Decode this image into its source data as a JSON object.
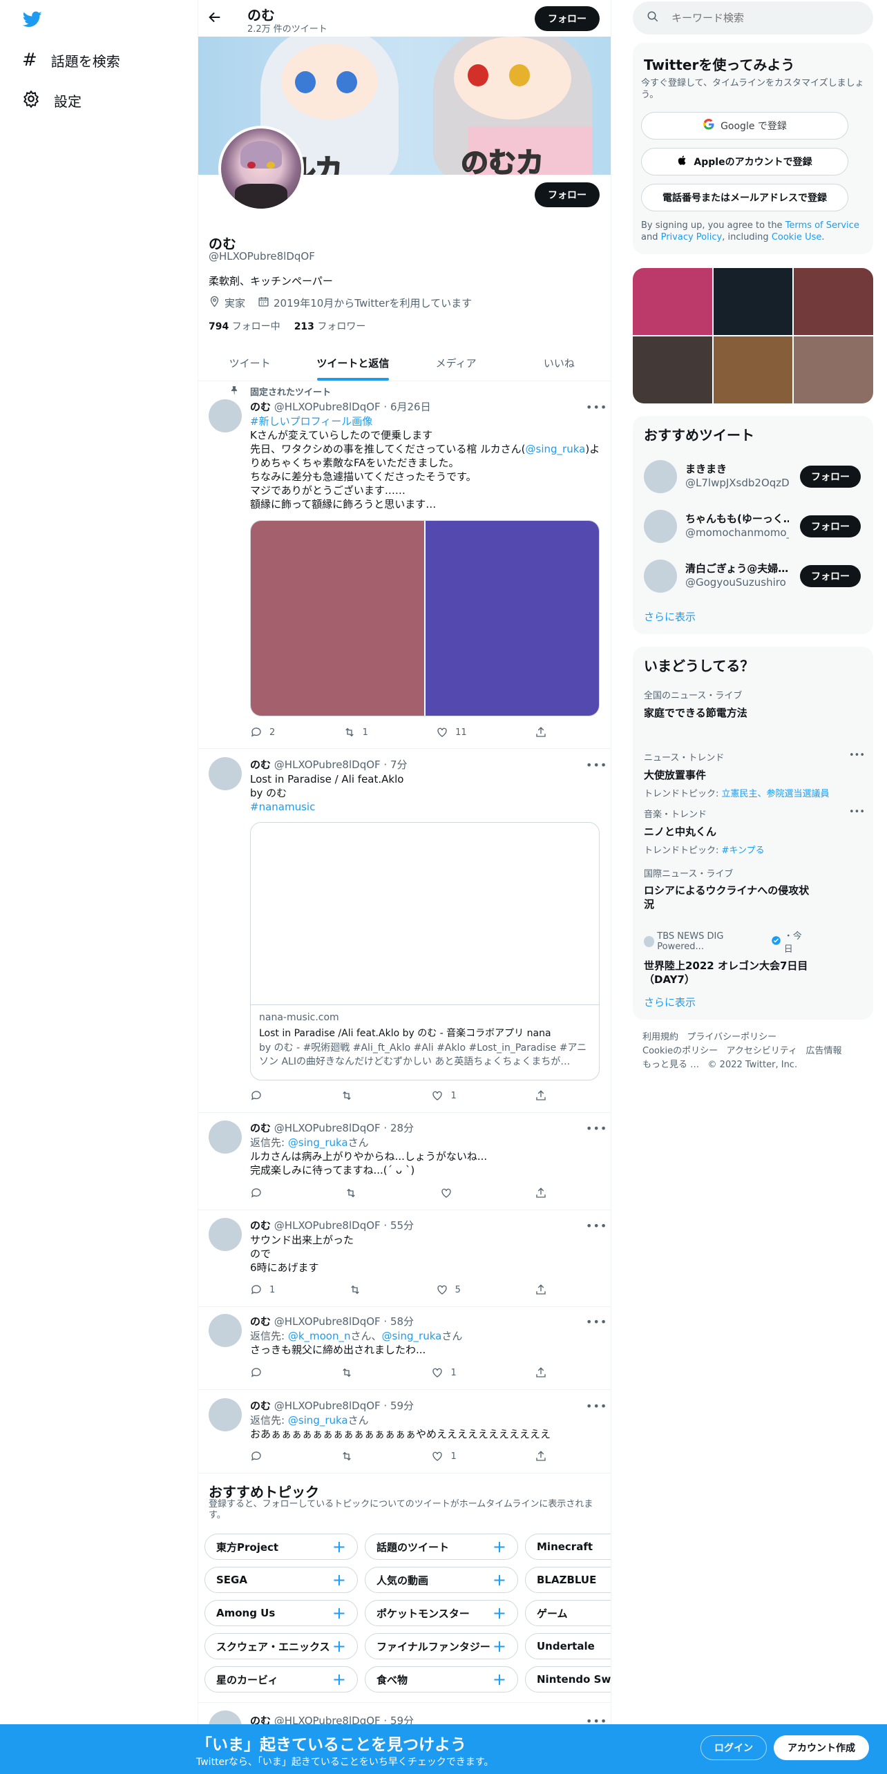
{
  "left_nav": {
    "explore_label": "話題を検索",
    "settings_label": "設定"
  },
  "header": {
    "name": "のむ",
    "tweet_count": "2.2万 件のツイート",
    "follow_label": "フォロー"
  },
  "banner": {
    "left_text": "ルカ",
    "right_text": "のむカ"
  },
  "profile": {
    "name": "のむ",
    "handle": "@HLXOPubre8lDqOF",
    "bio": "柔軟剤、キッチンペーパー",
    "location": "実家",
    "joined": "2019年10月からTwitterを利用しています",
    "following_count": "794",
    "following_label": "フォロー中",
    "followers_count": "213",
    "followers_label": "フォロワー",
    "follow_label": "フォロー"
  },
  "tabs": [
    {
      "label": "ツイート"
    },
    {
      "label": "ツイートと返信"
    },
    {
      "label": "メディア"
    },
    {
      "label": "いいね"
    }
  ],
  "tweets": [
    {
      "pinned_label": "固定されたツイート",
      "name": "のむ",
      "meta": "@HLXOPubre8lDqOF · 6月26日",
      "hashtag": "#新しいプロフィール画像",
      "line1": "Kさんが変えていらしたので便乗します",
      "line2a": "先日、ワタクシめの事を推してくださっている棺 ルカさん(",
      "mention": "@sing_ruka",
      "line2b": ")よ",
      "line3": "りめちゃくちゃ素敵なFAをいただきました。",
      "line4": "ちなみに差分も急遽描いてくださったそうです。",
      "line5": "マジでありがとうございます……",
      "line6": "額縁に飾って額縁に飾ろうと思います…",
      "media_colors": [
        "#a4606c",
        "#5349ae"
      ],
      "replies": "2",
      "retweets": "1",
      "likes": "11"
    },
    {
      "name": "のむ",
      "meta": "@HLXOPubre8lDqOF · 7分",
      "line1": "Lost in Paradise / Ali feat.Aklo",
      "line2": "by のむ",
      "hashtag": "#nanamusic",
      "card_domain": "nana-music.com",
      "card_title": "Lost in Paradise /Ali feat.Aklo by のむ - 音楽コラボアプリ nana",
      "card_desc": "by のむ - #呪術廻戦 #Ali_ft_Aklo #Ali #Aklo #Lost_in_Paradise #アニソン ALIの曲好きなんだけどむずかしい あと英語ちょくちょくまちが…",
      "likes": "1"
    },
    {
      "name": "のむ",
      "meta": "@HLXOPubre8lDqOF · 28分",
      "reply_prefix": "返信先: ",
      "reply_to": "@sing_ruka",
      "reply_suffix": "さん",
      "line1": "ルカさんは病み上がりやからね...しょうがないね...",
      "line2": "完成楽しみに待ってますね...(´ ᴗ `)"
    },
    {
      "name": "のむ",
      "meta": "@HLXOPubre8lDqOF · 55分",
      "line1": "サウンド出来上がった",
      "line2": "ので",
      "line3": "6時にあげます",
      "replies": "1",
      "likes": "5"
    },
    {
      "name": "のむ",
      "meta": "@HLXOPubre8lDqOF · 58分",
      "reply_prefix": "返信先: ",
      "reply_to1": "@k_moon_n",
      "reply_mid": "さん、",
      "reply_to2": "@sing_ruka",
      "reply_suffix": "さん",
      "line1": "さっきも親父に締め出されましたわ...",
      "likes": "1"
    },
    {
      "name": "のむ",
      "meta": "@HLXOPubre8lDqOF · 59分",
      "reply_prefix": "返信先: ",
      "reply_to": "@sing_ruka",
      "reply_suffix": "さん",
      "line1": "おあぁぁぁぁぁぁぁぁぁぁぁぁぁぁやめえええええええええええ",
      "likes": "1"
    }
  ],
  "topics": {
    "title": "おすすめトピック",
    "desc": "登録すると、フォローしているトピックについてのツイートがホームタイムラインに表示されます。",
    "items": [
      "東方Project",
      "話題のツイート",
      "Minecraft",
      "SEGA",
      "人気の動画",
      "BLAZBLUE",
      "Among Us",
      "ポケットモンスター",
      "ゲーム",
      "スクウェア・エニックス",
      "ファイナルファンタジー",
      "Undertale",
      "星のカービィ",
      "食べ物",
      "Nintendo Switch"
    ]
  },
  "peek_tweet": {
    "name": "のむ",
    "meta": "@HLXOPubre8lDqOF · 59分"
  },
  "search": {
    "placeholder": "キーワード検索"
  },
  "signup": {
    "title": "Twitterを使ってみよう",
    "desc": "今すぐ登録して、タイムラインをカスタマイズしましょう。",
    "google": "Google で登録",
    "apple": "Appleのアカウントで登録",
    "phone": "電話番号またはメールアドレスで登録",
    "terms_a": "By signing up, you agree to the ",
    "terms_link1": "Terms of Service",
    "terms_b": " and ",
    "terms_link2": "Privacy Policy",
    "terms_c": ", including ",
    "terms_link3": "Cookie Use",
    "terms_d": "."
  },
  "media_grid": {
    "colors": [
      "#bb3a6a",
      "#162028",
      "#733a3c",
      "#433a37",
      "#875e3a",
      "#8c6e64"
    ]
  },
  "recommended": {
    "title": "おすすめツイート",
    "users": [
      {
        "name": "まきまき",
        "handle": "@L7lwpJXsdb2OqzD"
      },
      {
        "name": "ちゃんもも(ゆーっく…",
        "handle": "@momochanmomo_"
      },
      {
        "name": "清白ごぎょう@夫婦…",
        "handle": "@GogyouSuzushiro"
      }
    ],
    "follow_label": "フォロー",
    "more": "さらに表示"
  },
  "trends": {
    "title": "いまどうしてる？",
    "items": [
      {
        "sub": "全国のニュース・ライブ",
        "title": "家庭でできる節電方法"
      },
      {
        "sub": "ニュース・トレンド",
        "title": "大使放置事件",
        "topic_prefix": "トレンドトピック: ",
        "topic": "立憲民主、参院選当選議員"
      },
      {
        "sub": "音楽・トレンド",
        "title": "ニノと中丸くん",
        "topic_prefix": "トレンドトピック: ",
        "topic": "#キンプる"
      },
      {
        "sub": "国際ニュース・ライブ",
        "title": "ロシアによるウクライナへの侵攻状況"
      },
      {
        "source": "TBS NEWS DIG Powered...",
        "time": "・今日",
        "title": "世界陸上2022 オレゴン大会7日目（DAY7）"
      }
    ],
    "more": "さらに表示"
  },
  "footer": {
    "links": [
      "利用規約",
      "プライバシーポリシー",
      "Cookieのポリシー",
      "アクセシビリティ",
      "広告情報",
      "もっと見る …"
    ],
    "copyright": "© 2022 Twitter, Inc."
  },
  "bottom_bar": {
    "title": "「いま」起きていることを見つけよう",
    "desc": "Twitterなら、「いま」起きていることをいち早くチェックできます。",
    "login": "ログイン",
    "signup": "アカウント作成"
  }
}
